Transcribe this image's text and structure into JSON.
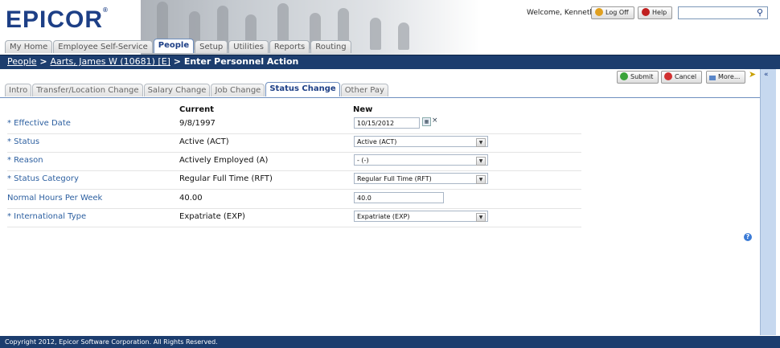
{
  "header": {
    "logo": "EPICOR",
    "welcome": "Welcome, Kenneth",
    "logoff_label": "Log Off",
    "help_label": "Help",
    "search_value": ""
  },
  "main_tabs": [
    {
      "label": "My Home"
    },
    {
      "label": "Employee Self-Service"
    },
    {
      "label": "People"
    },
    {
      "label": "Setup"
    },
    {
      "label": "Utilities"
    },
    {
      "label": "Reports"
    },
    {
      "label": "Routing"
    }
  ],
  "breadcrumb": {
    "root": "People",
    "sep1": " > ",
    "employee": "Aarts, James W (10681) [E]",
    "sep2": " > ",
    "page": "Enter Personnel Action"
  },
  "actions": {
    "submit_label": "Submit",
    "cancel_label": "Cancel",
    "more_label": "More..."
  },
  "sub_tabs": [
    {
      "label": "Intro"
    },
    {
      "label": "Transfer/Location Change"
    },
    {
      "label": "Salary Change"
    },
    {
      "label": "Job Change"
    },
    {
      "label": "Status Change"
    },
    {
      "label": "Other Pay"
    }
  ],
  "form": {
    "current_header": "Current",
    "new_header": "New",
    "rows": [
      {
        "label": "* Effective Date",
        "current": "9/8/1997",
        "new": "10/15/2012"
      },
      {
        "label": "* Status",
        "current": "Active (ACT)",
        "new": "Active (ACT)"
      },
      {
        "label": "* Reason",
        "current": "Actively Employed (A)",
        "new": "- (-)"
      },
      {
        "label": "* Status Category",
        "current": "Regular Full Time (RFT)",
        "new": "Regular Full Time (RFT)"
      },
      {
        "label": "Normal Hours Per Week",
        "current": "40.00",
        "new": "40.0"
      },
      {
        "label": "* International Type",
        "current": "Expatriate (EXP)",
        "new": "Expatriate (EXP)"
      }
    ]
  },
  "footer": {
    "copyright": "Copyright 2012, Epicor Software Corporation. All Rights Reserved."
  },
  "colors": {
    "brand": "#1d3f86",
    "navbar": "#1c3d6e",
    "label_blue": "#2c5fa0"
  }
}
